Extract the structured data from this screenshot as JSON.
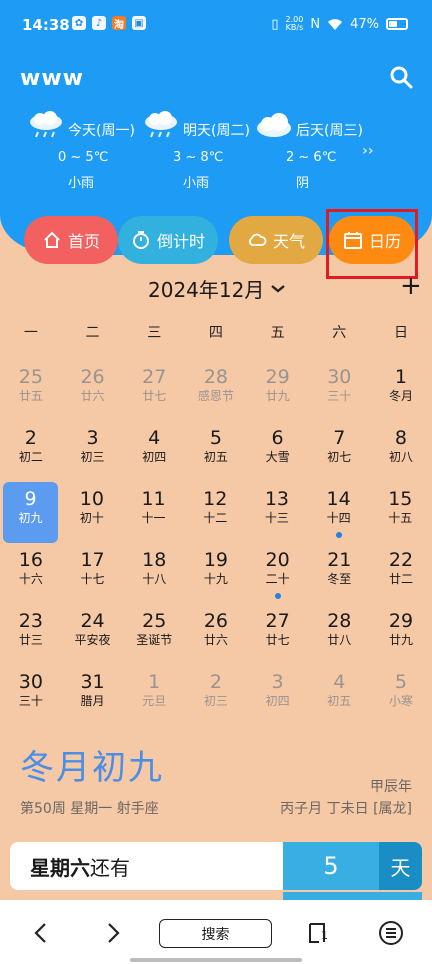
{
  "status": {
    "time": "14:38",
    "net_speed_value": "2.00",
    "net_speed_unit": "KB/s",
    "battery": "47%"
  },
  "app": {
    "title": "www"
  },
  "weather": [
    {
      "day": "今天(周一)",
      "temp": "0 ~ 5℃",
      "cond": "小雨",
      "icon": "rain-cloud-icon"
    },
    {
      "day": "明天(周二)",
      "temp": "3 ~ 8℃",
      "cond": "小雨",
      "icon": "rain-cloud-icon"
    },
    {
      "day": "后天(周三)",
      "temp": "2 ~ 6℃",
      "cond": "阴",
      "icon": "cloud-icon"
    }
  ],
  "nav": [
    {
      "label": "首页",
      "icon": "home-icon",
      "color": "#f26060"
    },
    {
      "label": "倒计时",
      "icon": "timer-icon",
      "color": "#32b0de"
    },
    {
      "label": "天气",
      "icon": "cloud-icon",
      "color": "#e2a842"
    },
    {
      "label": "日历",
      "icon": "calendar-icon",
      "color": "#ff8a12"
    }
  ],
  "calendar": {
    "month_title": "2024年12月",
    "weekdays": [
      "一",
      "二",
      "三",
      "四",
      "五",
      "六",
      "日"
    ],
    "weeks": [
      [
        {
          "d": "25",
          "l": "廿五",
          "other": true
        },
        {
          "d": "26",
          "l": "廿六",
          "other": true
        },
        {
          "d": "27",
          "l": "廿七",
          "other": true
        },
        {
          "d": "28",
          "l": "感恩节",
          "other": true
        },
        {
          "d": "29",
          "l": "廿九",
          "other": true
        },
        {
          "d": "30",
          "l": "三十",
          "other": true
        },
        {
          "d": "1",
          "l": "冬月"
        }
      ],
      [
        {
          "d": "2",
          "l": "初二"
        },
        {
          "d": "3",
          "l": "初三"
        },
        {
          "d": "4",
          "l": "初四"
        },
        {
          "d": "5",
          "l": "初五"
        },
        {
          "d": "6",
          "l": "大雪"
        },
        {
          "d": "7",
          "l": "初七"
        },
        {
          "d": "8",
          "l": "初八"
        }
      ],
      [
        {
          "d": "9",
          "l": "初九",
          "today": true
        },
        {
          "d": "10",
          "l": "初十"
        },
        {
          "d": "11",
          "l": "十一"
        },
        {
          "d": "12",
          "l": "十二"
        },
        {
          "d": "13",
          "l": "十三"
        },
        {
          "d": "14",
          "l": "十四",
          "dot": true
        },
        {
          "d": "15",
          "l": "十五"
        }
      ],
      [
        {
          "d": "16",
          "l": "十六"
        },
        {
          "d": "17",
          "l": "十七"
        },
        {
          "d": "18",
          "l": "十八"
        },
        {
          "d": "19",
          "l": "十九"
        },
        {
          "d": "20",
          "l": "二十",
          "dot": true
        },
        {
          "d": "21",
          "l": "冬至"
        },
        {
          "d": "22",
          "l": "廿二"
        }
      ],
      [
        {
          "d": "23",
          "l": "廿三"
        },
        {
          "d": "24",
          "l": "平安夜"
        },
        {
          "d": "25",
          "l": "圣诞节"
        },
        {
          "d": "26",
          "l": "廿六"
        },
        {
          "d": "27",
          "l": "廿七"
        },
        {
          "d": "28",
          "l": "廿八"
        },
        {
          "d": "29",
          "l": "廿九"
        }
      ],
      [
        {
          "d": "30",
          "l": "三十"
        },
        {
          "d": "31",
          "l": "腊月"
        },
        {
          "d": "1",
          "l": "元旦",
          "other": true
        },
        {
          "d": "2",
          "l": "初三",
          "other": true
        },
        {
          "d": "3",
          "l": "初四",
          "other": true
        },
        {
          "d": "4",
          "l": "初五",
          "other": true
        },
        {
          "d": "5",
          "l": "小寒",
          "other": true
        }
      ]
    ]
  },
  "detail": {
    "lunar_big": "冬月初九",
    "year_ganzhi": "甲辰年",
    "week_info": "第50周  星期一  射手座",
    "ganzhi_info": "丙子月 丁未日 [属龙]"
  },
  "countdown": {
    "label_bold": "星期六",
    "label_rest": "还有",
    "value": "5",
    "unit": "天"
  },
  "bottom": {
    "search_label": "搜索",
    "tab_count": "1"
  }
}
